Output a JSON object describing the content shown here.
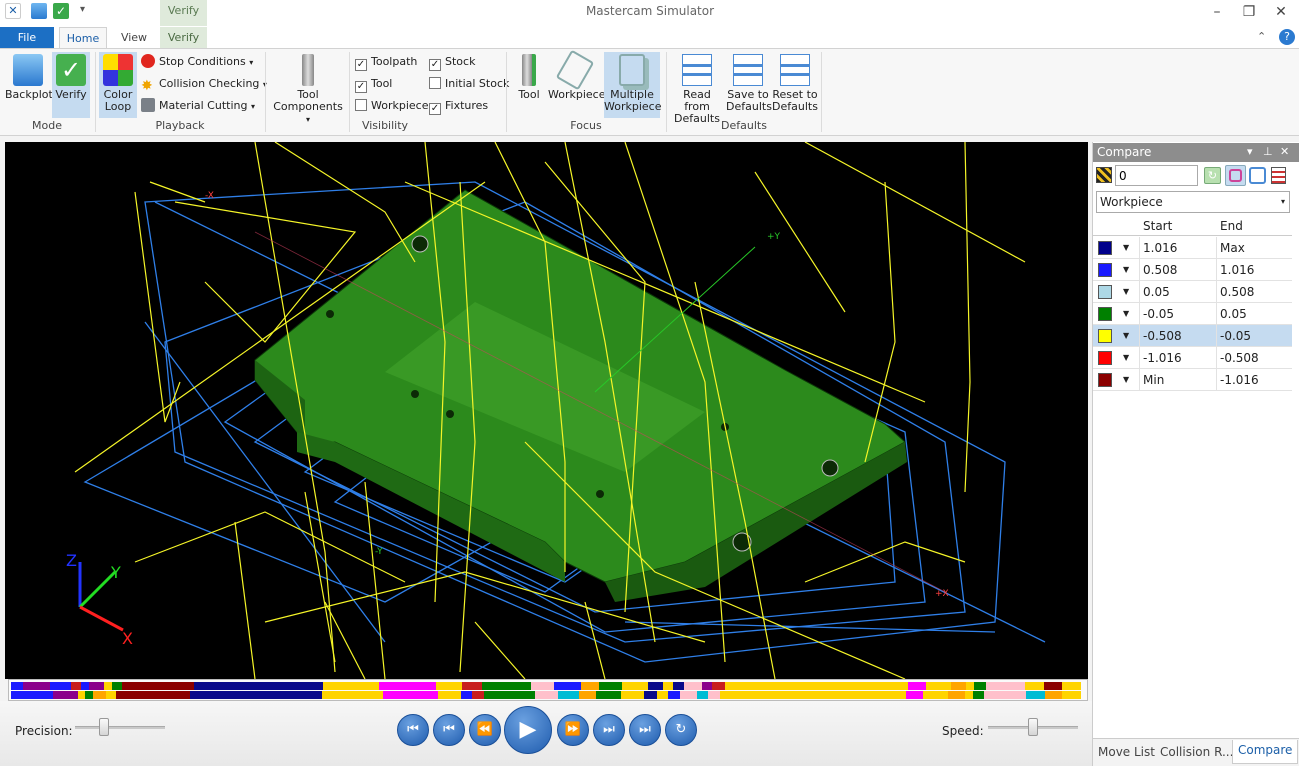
{
  "window": {
    "title": "Mastercam Simulator",
    "contextual_tab_group": "Verify"
  },
  "tabs": {
    "file": "File",
    "home": "Home",
    "view": "View",
    "verify": "Verify"
  },
  "ribbon": {
    "mode": {
      "label": "Mode",
      "backplot": "Backplot",
      "verify": "Verify"
    },
    "playback": {
      "label": "Playback",
      "color_loop": [
        "Color",
        "Loop"
      ],
      "stop_conditions": "Stop Conditions",
      "collision_checking": "Collision Checking",
      "material_cutting": "Material Cutting"
    },
    "tool_components": [
      "Tool",
      "Components"
    ],
    "visibility": {
      "label": "Visibility",
      "toolpath": {
        "label": "Toolpath",
        "checked": true
      },
      "tool": {
        "label": "Tool",
        "checked": true
      },
      "workpiece": {
        "label": "Workpiece",
        "checked": false
      },
      "stock": {
        "label": "Stock",
        "checked": true
      },
      "initial_stock": {
        "label": "Initial Stock",
        "checked": false
      },
      "fixtures": {
        "label": "Fixtures",
        "checked": true
      }
    },
    "focus": {
      "label": "Focus",
      "tool": "Tool",
      "workpiece": "Workpiece",
      "multiple_workpiece": [
        "Multiple",
        "Workpiece"
      ]
    },
    "defaults": {
      "label": "Defaults",
      "read": [
        "Read from",
        "Defaults"
      ],
      "save": [
        "Save to",
        "Defaults"
      ],
      "reset": [
        "Reset to",
        "Defaults"
      ]
    }
  },
  "viewport": {
    "axis_labels": {
      "z": "Z",
      "y": "Y",
      "x": "X",
      "plus_y": "+Y",
      "minus_y": "-Y",
      "plus_x": "+X",
      "minus_x": "-X"
    }
  },
  "timeline": {
    "top": [
      [
        "#1a1aff",
        12
      ],
      [
        "#8b008b",
        26
      ],
      [
        "#1a1aff",
        20
      ],
      [
        "#c81e1e",
        10
      ],
      [
        "#1a1aff",
        8
      ],
      [
        "#8b008b",
        14
      ],
      [
        "#ffd400",
        8
      ],
      [
        "#008000",
        10
      ],
      [
        "#8b0000",
        70
      ],
      [
        "#0a0a8a",
        125
      ],
      [
        "#ffd400",
        55
      ],
      [
        "#ff00ff",
        55
      ],
      [
        "#ffd400",
        25
      ],
      [
        "#c81e1e",
        20
      ],
      [
        "#008000",
        48
      ],
      [
        "#ffc0cb",
        22
      ],
      [
        "#1a1aff",
        26
      ],
      [
        "#ffa500",
        18
      ],
      [
        "#008000",
        22
      ],
      [
        "#ffd400",
        25
      ],
      [
        "#0a0a8a",
        15
      ],
      [
        "#ffd400",
        10
      ],
      [
        "#0a0a8a",
        10
      ],
      [
        "#ffc0cb",
        18
      ],
      [
        "#8b008b",
        10
      ],
      [
        "#c81e1e",
        12
      ],
      [
        "#ffd400",
        178
      ],
      [
        "#ff00ff",
        18
      ],
      [
        "#ffd400",
        24
      ],
      [
        "#ffa500",
        14
      ],
      [
        "#ffd400",
        8
      ],
      [
        "#008000",
        12
      ],
      [
        "#ffc0cb",
        38
      ],
      [
        "#ffd400",
        18
      ],
      [
        "#8b0000",
        18
      ],
      [
        "#ffd400",
        18
      ]
    ],
    "bottom": [
      [
        "#1a1aff",
        40
      ],
      [
        "#8b008b",
        24
      ],
      [
        "#ffd400",
        6
      ],
      [
        "#008000",
        8
      ],
      [
        "#ffa500",
        12
      ],
      [
        "#ffd400",
        10
      ],
      [
        "#8b0000",
        70
      ],
      [
        "#0a0a8a",
        125
      ],
      [
        "#ffd400",
        58
      ],
      [
        "#ff00ff",
        52
      ],
      [
        "#ffd400",
        22
      ],
      [
        "#1a1aff",
        10
      ],
      [
        "#c81e1e",
        12
      ],
      [
        "#008000",
        48
      ],
      [
        "#ffc0cb",
        22
      ],
      [
        "#00bcd4",
        20
      ],
      [
        "#ffa500",
        16
      ],
      [
        "#008000",
        24
      ],
      [
        "#ffd400",
        22
      ],
      [
        "#0a0a8a",
        12
      ],
      [
        "#ffd400",
        10
      ],
      [
        "#1a1aff",
        12
      ],
      [
        "#ffc0cb",
        16
      ],
      [
        "#00bcd4",
        10
      ],
      [
        "#ffc0cb",
        12
      ],
      [
        "#ffd400",
        176
      ],
      [
        "#ff00ff",
        16
      ],
      [
        "#ffd400",
        24
      ],
      [
        "#ffa500",
        16
      ],
      [
        "#ffd400",
        8
      ],
      [
        "#008000",
        10
      ],
      [
        "#ffc0cb",
        40
      ],
      [
        "#00bcd4",
        18
      ],
      [
        "#ffa500",
        16
      ],
      [
        "#ffd400",
        18
      ]
    ]
  },
  "controls": {
    "precision_label": "Precision:",
    "speed_label": "Speed:",
    "precision": 0.3,
    "speed": 0.5
  },
  "panel": {
    "title": "Compare",
    "value_input": "0",
    "target_select": "Workpiece",
    "columns": {
      "start": "Start",
      "end": "End"
    },
    "rows": [
      {
        "color": "#00008b",
        "start": "1.016",
        "end": "Max"
      },
      {
        "color": "#1a1aff",
        "start": "0.508",
        "end": "1.016"
      },
      {
        "color": "#add8e6",
        "start": "0.05",
        "end": "0.508"
      },
      {
        "color": "#008000",
        "start": "-0.05",
        "end": "0.05"
      },
      {
        "color": "#ffff00",
        "start": "-0.508",
        "end": "-0.05",
        "selected": true
      },
      {
        "color": "#ff0000",
        "start": "-1.016",
        "end": "-0.508"
      },
      {
        "color": "#8b0000",
        "start": "Min",
        "end": "-1.016"
      }
    ],
    "tabs": [
      "Move List",
      "Collision R...",
      "Compare"
    ]
  }
}
